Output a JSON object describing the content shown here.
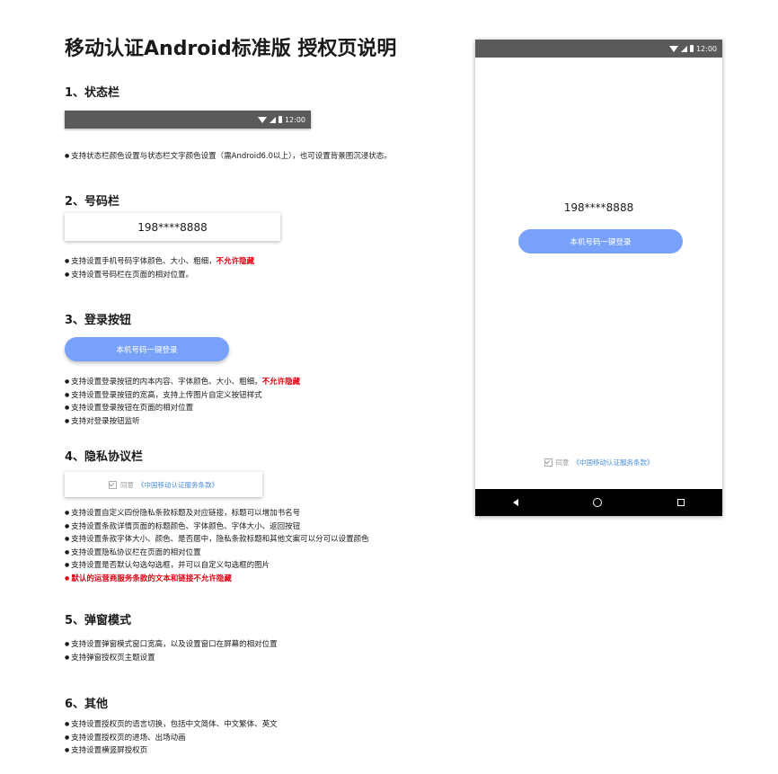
{
  "title": "移动认证Android标准版 授权页说明",
  "status_time": "12:00",
  "sections": [
    {
      "heading": "1、状态栏",
      "bullets": [
        "支持状态栏颜色设置与状态栏文字颜色设置（需Android6.0以上），也可设置背景图沉浸状态。"
      ]
    },
    {
      "heading": "2、号码栏",
      "number": "198****8888",
      "bullets": [
        {
          "text": "支持设置手机号码字体颜色、大小、粗细，",
          "red": "不允许隐藏"
        },
        "支持设置号码栏在页面的相对位置。"
      ]
    },
    {
      "heading": "3、登录按钮",
      "button": "本机号码一键登录",
      "bullets": [
        {
          "text": "支持设置登录按钮的内本内容、字体颜色、大小、粗细，",
          "red": "不允许隐藏"
        },
        "支持设置登录按钮的宽高，支持上传图片自定义按钮样式",
        "支持设置登录按钮在页面的相对位置",
        "支持对登录按钮监听"
      ]
    },
    {
      "heading": "4、隐私协议栏",
      "agree": "同意",
      "terms": "《中国移动认证服务条款》",
      "bullets": [
        "支持设置自定义四份隐私条款标题及对应链接，标题可以增加书名号",
        "支持设置条款详情页面的标题颜色、字体颜色、字体大小、返回按钮",
        "支持设置条款字体大小、颜色、是否居中，隐私条款标题和其他文案可以分可以设置颜色",
        "支持设置隐私协议栏在页面的相对位置",
        "支持设置是否默认勾选勾选框，并可以自定义勾选框的图片"
      ],
      "red_bullet": "默认的运营商服务条款的文本和链接不允许隐藏"
    },
    {
      "heading": "5、弹窗模式",
      "bullets": [
        "支持设置弹窗模式窗口宽高，以及设置窗口在屏幕的相对位置",
        "支持弹窗授权页主题设置"
      ]
    },
    {
      "heading": "6、其他",
      "bullets": [
        "支持设置授权页的语言切换，包括中文简体、中文繁体、英文",
        "支持设置授权页的进场、出场动画",
        "支持设置横竖屏授权页"
      ]
    }
  ]
}
